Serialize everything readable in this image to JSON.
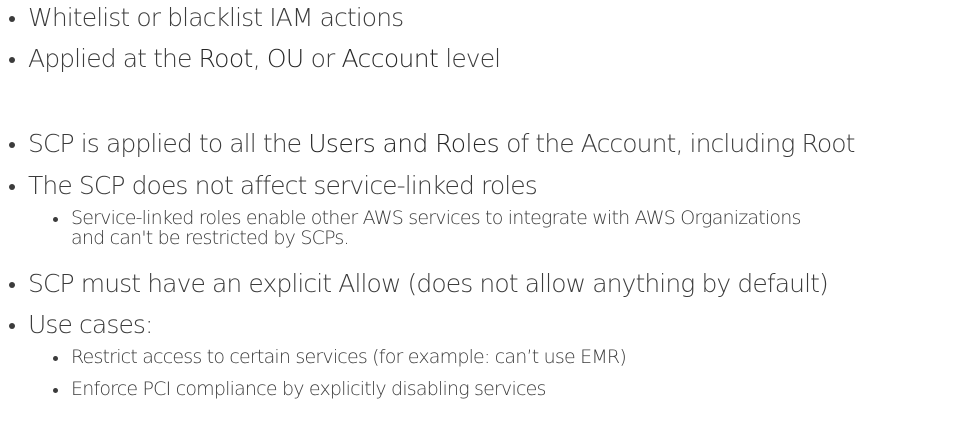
{
  "bullets": [
    {
      "text": "Whitelist or blacklist IAM actions"
    },
    {
      "pre": "Applied at the ",
      "b1": "Root",
      "mid1": ", ",
      "b2": "OU",
      "mid2": " or ",
      "b3": "Account",
      "post": " level"
    },
    {
      "pre": "SCP is applied to all the ",
      "b1": "Users and Roles",
      "post": " of the Account, including Root"
    },
    {
      "text": "The SCP does not affect service-linked roles"
    },
    {
      "line1": "Service-linked roles enable other AWS services to integrate with AWS Organizations",
      "line2": "and can't be restricted by SCPs."
    },
    {
      "text": "SCP must have an explicit Allow (does not allow anything by default)"
    },
    {
      "text": "Use cases:"
    },
    {
      "text": "Restrict access to certain services (for example: can’t use EMR)"
    },
    {
      "text": "Enforce PCI compliance by explicitly disabling services"
    }
  ]
}
